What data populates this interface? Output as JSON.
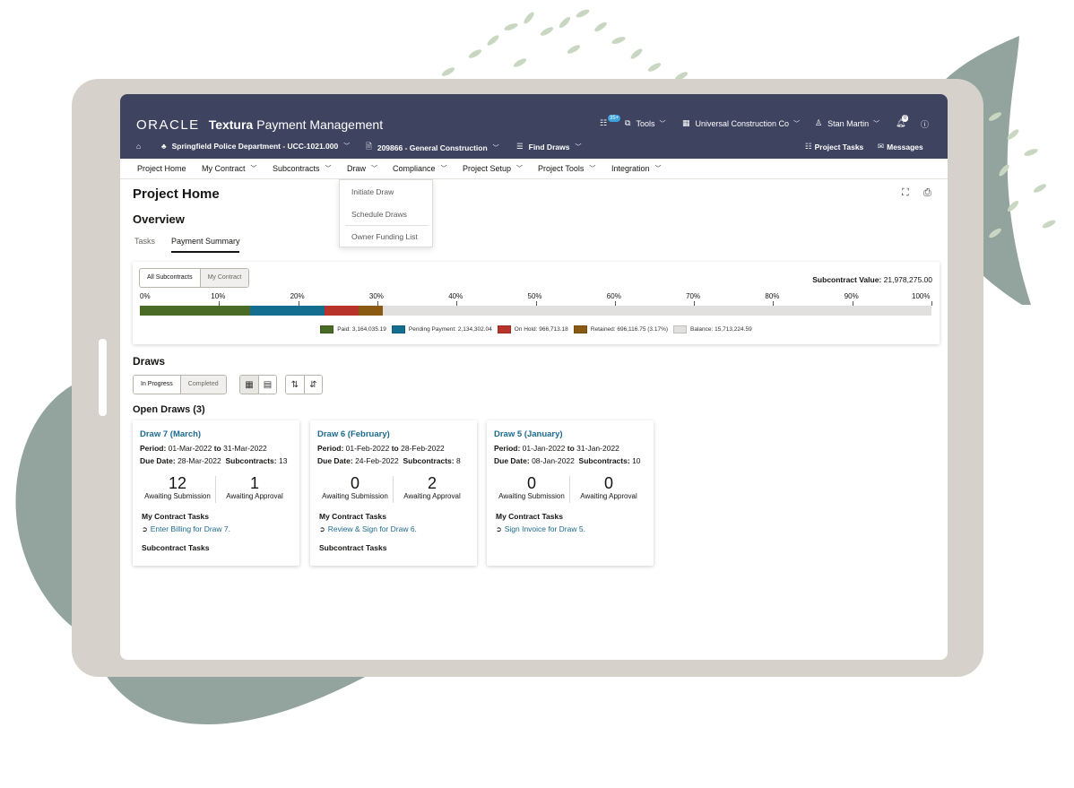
{
  "brand": {
    "oracle": "ORACLE",
    "product": "Textura",
    "module": "Payment Management"
  },
  "header_right": {
    "tasks_badge": "35+",
    "tools": "Tools",
    "company": "Universal Construction Co",
    "user": "Stan Martin",
    "notifications_badge": "0"
  },
  "context": {
    "project": "Springfield Police Department - UCC-1021.000",
    "contract": "209866 - General Construction",
    "find_draws": "Find Draws",
    "project_tasks": "Project Tasks",
    "messages": "Messages"
  },
  "nav": {
    "project_home": "Project Home",
    "my_contract": "My Contract",
    "subcontracts": "Subcontracts",
    "draw": "Draw",
    "compliance": "Compliance",
    "project_setup": "Project Setup",
    "project_tools": "Project Tools",
    "integration": "Integration"
  },
  "draw_menu": {
    "initiate": "Initiate Draw",
    "schedule": "Schedule Draws",
    "owner_funding": "Owner Funding List"
  },
  "page": {
    "title": "Project Home",
    "overview": "Overview",
    "tabs": [
      "Tasks",
      "Payment Summary"
    ]
  },
  "summary": {
    "toggle": [
      "All Subcontracts",
      "My Contract"
    ],
    "value_label": "Subcontract Value:",
    "value": "21,978,275.00",
    "ticks": [
      "0%",
      "10%",
      "20%",
      "30%",
      "40%",
      "50%",
      "60%",
      "70%",
      "80%",
      "90%",
      "100%"
    ],
    "segments": [
      {
        "label": "Paid: 3,164,035.19",
        "amount": 3164035.19,
        "color": "#4a6b26"
      },
      {
        "label": "Pending Payment: 2,134,302.04",
        "amount": 2134302.04,
        "color": "#146e90"
      },
      {
        "label": "On Hold: 966,713.18",
        "amount": 966713.18,
        "color": "#b8332a"
      },
      {
        "label": "Retained: 696,116.75 (3.17%)",
        "amount": 696116.75,
        "color": "#8a5a12"
      },
      {
        "label": "Balance: 15,713,224.59",
        "amount": 15713224.59,
        "color": "#e1e0de"
      }
    ]
  },
  "draws": {
    "title": "Draws",
    "toggle": [
      "In Progress",
      "Completed"
    ],
    "open_title": "Open Draws (3)",
    "cards": [
      {
        "title": "Draw 7 (March)",
        "period_label": "Period:",
        "period_start": "01-Mar-2022",
        "to": "to",
        "period_end": "31-Mar-2022",
        "due_label": "Due Date:",
        "due": "28-Mar-2022",
        "subs_label": "Subcontracts:",
        "subs": "13",
        "awaiting_submission": "12",
        "awaiting_submission_label": "Awaiting Submission",
        "awaiting_approval": "1",
        "awaiting_approval_label": "Awaiting Approval",
        "my_tasks_label": "My Contract Tasks",
        "task": "Enter Billing for Draw 7.",
        "sub_tasks_label": "Subcontract Tasks"
      },
      {
        "title": "Draw 6 (February)",
        "period_label": "Period:",
        "period_start": "01-Feb-2022",
        "to": "to",
        "period_end": "28-Feb-2022",
        "due_label": "Due Date:",
        "due": "24-Feb-2022",
        "subs_label": "Subcontracts:",
        "subs": "8",
        "awaiting_submission": "0",
        "awaiting_submission_label": "Awaiting Submission",
        "awaiting_approval": "2",
        "awaiting_approval_label": "Awaiting Approval",
        "my_tasks_label": "My Contract Tasks",
        "task": "Review & Sign for Draw 6.",
        "sub_tasks_label": "Subcontract Tasks"
      },
      {
        "title": "Draw 5 (January)",
        "period_label": "Period:",
        "period_start": "01-Jan-2022",
        "to": "to",
        "period_end": "31-Jan-2022",
        "due_label": "Due Date:",
        "due": "08-Jan-2022",
        "subs_label": "Subcontracts:",
        "subs": "10",
        "awaiting_submission": "0",
        "awaiting_submission_label": "Awaiting Submission",
        "awaiting_approval": "0",
        "awaiting_approval_label": "Awaiting Approval",
        "my_tasks_label": "My Contract Tasks",
        "task": "Sign Invoice for Draw 5.",
        "sub_tasks_label": ""
      }
    ]
  },
  "colors": {
    "header": "#3e4360",
    "link": "#1d6a8f",
    "tablet": "#d6d1cb",
    "leaf": "#93a39e"
  }
}
